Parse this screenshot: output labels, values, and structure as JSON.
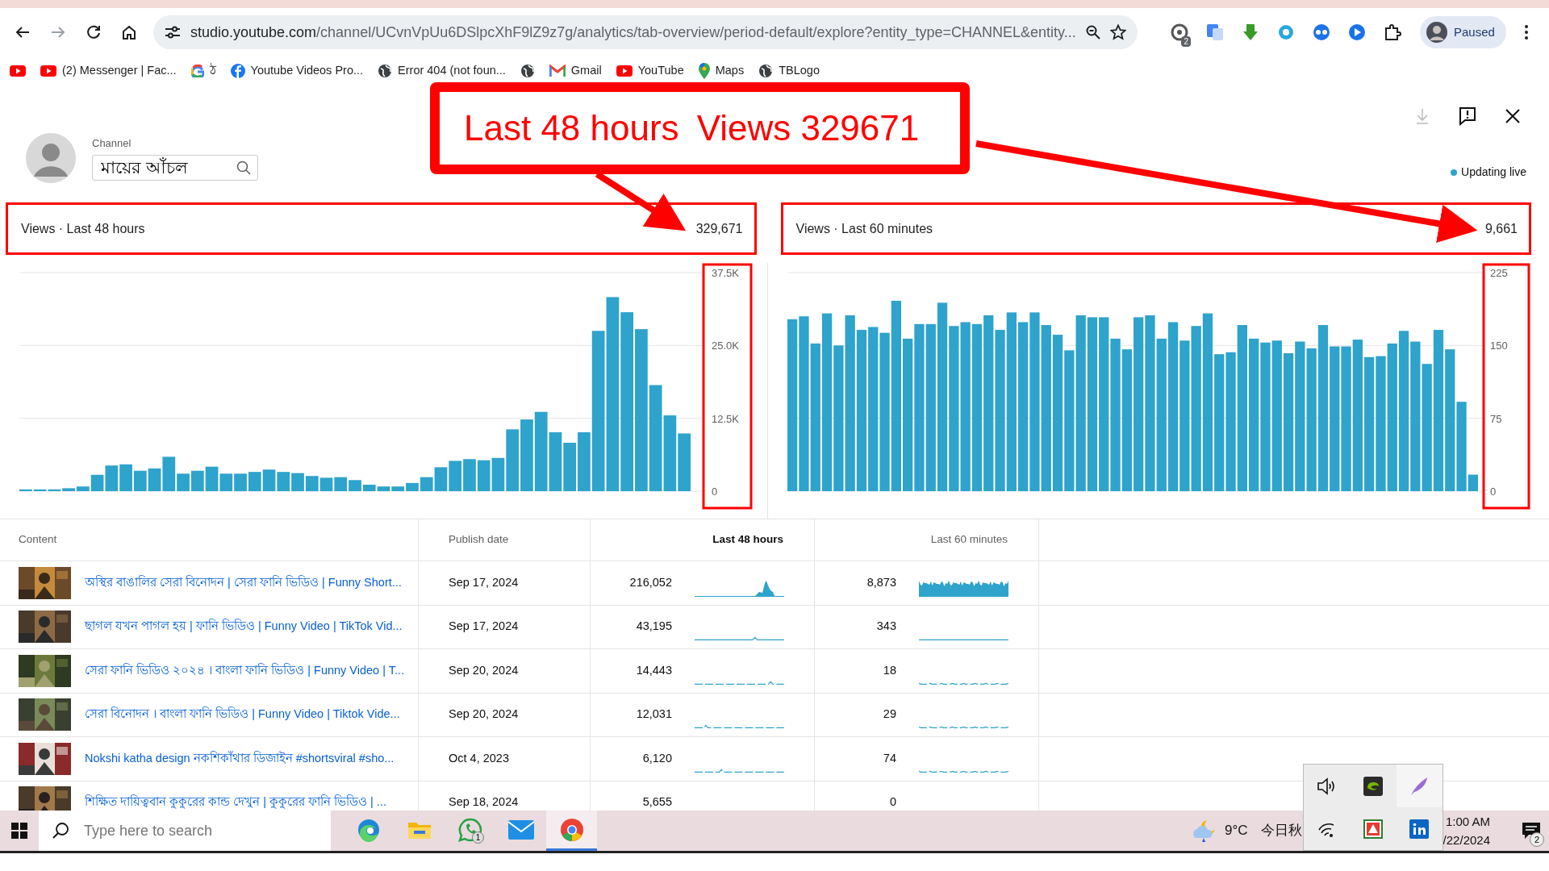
{
  "browser": {
    "url": "studio.youtube.com/channel/UCvnVpUu6DSlpcXhF9lZ9z7g/analytics/tab-overview/period-default/explore?entity_type=CHANNEL&entity...",
    "extension_badge": "2",
    "profile": "Paused",
    "bookmarks": [
      {
        "kind": "video"
      },
      {
        "kind": "video",
        "label": "(2) Messenger | Fac..."
      },
      {
        "kind": "search",
        "label": "ঠ"
      },
      {
        "kind": "social",
        "label": "Youtube Videos Pro..."
      },
      {
        "kind": "web",
        "label": "Error 404 (not foun..."
      },
      {
        "kind": "web"
      },
      {
        "kind": "mail",
        "label": "Gmail"
      },
      {
        "kind": "video",
        "label": "YouTube"
      },
      {
        "kind": "map",
        "label": "Maps"
      },
      {
        "kind": "web",
        "label": "TBLogo"
      }
    ]
  },
  "callout": {
    "texts": [
      "Last 48 hours",
      "Views 329671"
    ]
  },
  "header": {
    "channel_label": "Channel",
    "channel_name": "মায়ের আঁচল",
    "status": "Updating live"
  },
  "panels": [
    {
      "title": "Views · Last 48 hours",
      "total": "329,671",
      "highlighted": true,
      "axis_highlighted": true,
      "chart_data": {
        "type": "bar",
        "ylim": [
          0,
          37500
        ],
        "yticks": [
          0,
          {
            "value": 12500,
            "label": "12.5K"
          },
          {
            "value": 25000,
            "label": "25.0K"
          },
          {
            "value": 37500,
            "label": "37.5K"
          }
        ],
        "series": [
          {
            "color": "#2ea3cc",
            "values": [
              300,
              300,
              300,
              500,
              800,
              2800,
              4400,
              4600,
              3500,
              3900,
              5900,
              3000,
              3500,
              4200,
              3000,
              3000,
              3300,
              3700,
              3300,
              3100,
              2600,
              2300,
              2400,
              1900,
              1100,
              800,
              800,
              1400,
              2400,
              4100,
              5200,
              5500,
              5300,
              5700,
              10600,
              12300,
              13600,
              10100,
              8300,
              10100,
              27500,
              33300,
              30700,
              27800,
              18200,
              13000,
              9900
            ]
          }
        ]
      }
    },
    {
      "title": "Views · Last 60 minutes",
      "total": "9,661",
      "highlighted": true,
      "axis_highlighted": true,
      "chart_data": {
        "type": "bar",
        "ylim": [
          0,
          225
        ],
        "yticks": [
          0,
          75,
          150,
          225
        ],
        "series": [
          {
            "color": "#2ea3cc",
            "values": [
              177,
              180,
              152,
              183,
              150,
              181,
              166,
              169,
              163,
              196,
              157,
              172,
              172,
              194,
              170,
              174,
              172,
              181,
              166,
              184,
              174,
              184,
              171,
              161,
              145,
              181,
              179,
              179,
              157,
              146,
              179,
              181,
              157,
              174,
              155,
              170,
              183,
              141,
              143,
              171,
              157,
              153,
              155,
              142,
              154,
              147,
              171,
              149,
              149,
              156,
              138,
              139,
              152,
              165,
              154,
              131,
              166,
              146,
              92,
              17
            ]
          }
        ]
      }
    }
  ],
  "table": {
    "columns": [
      {
        "label": "Content",
        "sorted": false
      },
      {
        "label": "Publish date",
        "sorted": false
      },
      {
        "label": "Last 48 hours",
        "sorted": true
      },
      {
        "label": "Last 60 minutes",
        "sorted": false
      }
    ],
    "rows": [
      {
        "title": "অস্থির বাঙালির সেরা বিনোদন | সেরা ফানি ভিডিও | Funny Short...",
        "publish_date": "Sep 17, 2024",
        "views_48h": "216,052",
        "views_60m": "8,873"
      },
      {
        "title": "ছাগল যখন পাগল হয় | ফানি ভিডিও | Funny Video | TikTok Vid...",
        "publish_date": "Sep 17, 2024",
        "views_48h": "43,195",
        "views_60m": "343"
      },
      {
        "title": "সেরা ফানি ভিডিও ২০২৪ । বাংলা ফানি ভিডিও | Funny Video | T...",
        "publish_date": "Sep 20, 2024",
        "views_48h": "14,443",
        "views_60m": "18"
      },
      {
        "title": "সেরা বিনোদন । বাংলা ফানি ভিডিও | Funny Video | Tiktok Vide...",
        "publish_date": "Sep 20, 2024",
        "views_48h": "12,031",
        "views_60m": "29"
      },
      {
        "title": "Nokshi katha design নকশিকাঁথার ডিজাইন #shortsviral #sho...",
        "publish_date": "Oct 4, 2023",
        "views_48h": "6,120",
        "views_60m": "74"
      },
      {
        "title": "শিক্ষিত দায়িত্ববান কুকুরের কান্ড দেখুন | কুকুরের ফানি ভিডিও | ...",
        "publish_date": "Sep 18, 2024",
        "views_48h": "5,655",
        "views_60m": "0"
      }
    ]
  },
  "taskbar": {
    "search_placeholder": "Type here to search",
    "apps": [
      {
        "kind": "edge",
        "selected": false
      },
      {
        "kind": "files",
        "selected": false
      },
      {
        "kind": "chat",
        "selected": false,
        "badge": "1"
      },
      {
        "kind": "mail",
        "selected": false
      },
      {
        "kind": "chrome",
        "selected": true
      }
    ],
    "weather": "9°C",
    "news": "今日秋",
    "time": "1:00 AM",
    "date": "/22/2024",
    "notification_badge": "2"
  }
}
